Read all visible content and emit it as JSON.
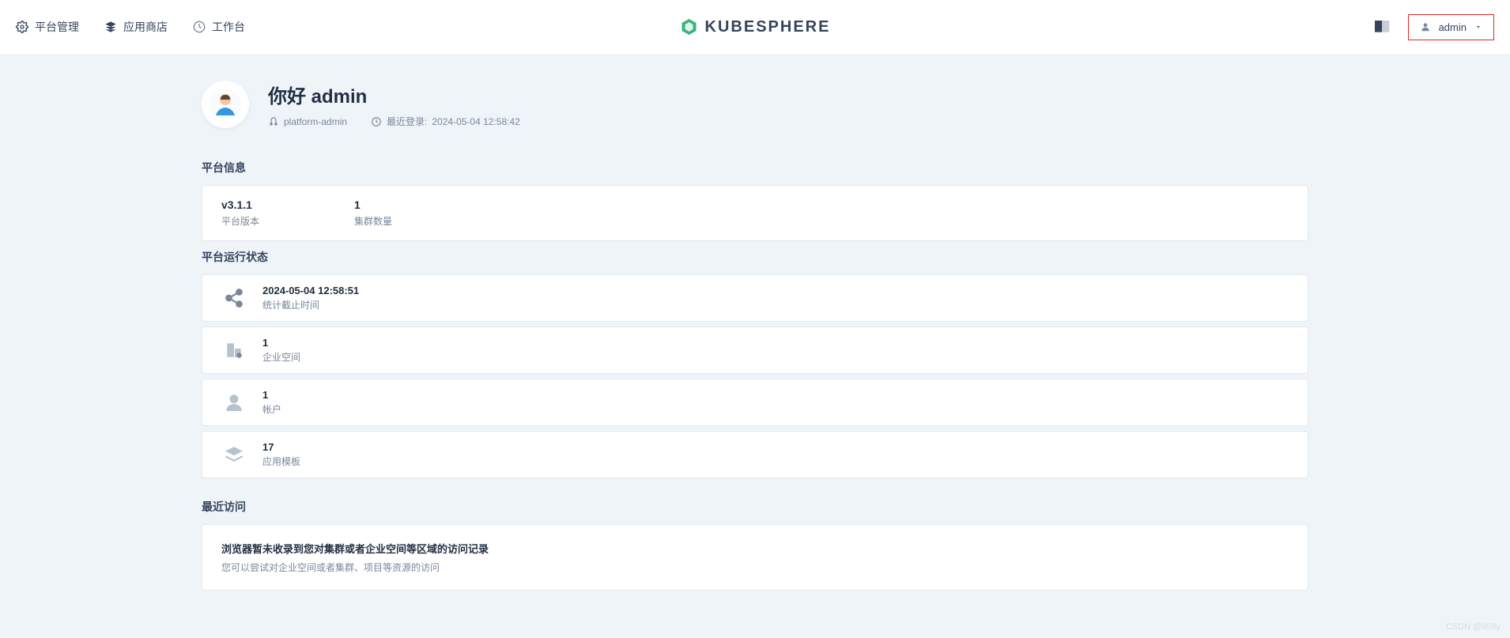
{
  "topbar": {
    "platform_mgmt": "平台管理",
    "app_store": "应用商店",
    "workbench": "工作台",
    "brand": "KUBESPHERE",
    "user": "admin"
  },
  "hero": {
    "greeting": "你好 admin",
    "role": "platform-admin",
    "last_login_label": "最近登录:",
    "last_login_time": "2024-05-04 12:58:42"
  },
  "platform_info": {
    "title": "平台信息",
    "version_value": "v3.1.1",
    "version_label": "平台版本",
    "cluster_value": "1",
    "cluster_label": "集群数量"
  },
  "platform_status": {
    "title": "平台运行状态",
    "stats_time_value": "2024-05-04 12:58:51",
    "stats_time_label": "统计截止时间",
    "workspace_value": "1",
    "workspace_label": "企业空间",
    "account_value": "1",
    "account_label": "帐户",
    "app_tpl_value": "17",
    "app_tpl_label": "应用模板"
  },
  "recent": {
    "title": "最近访问",
    "empty_title": "浏览器暂未收录到您对集群或者企业空间等区域的访问记录",
    "empty_sub": "您可以尝试对企业空间或者集群、项目等资源的访问"
  },
  "watermark": "CSDN @959y"
}
